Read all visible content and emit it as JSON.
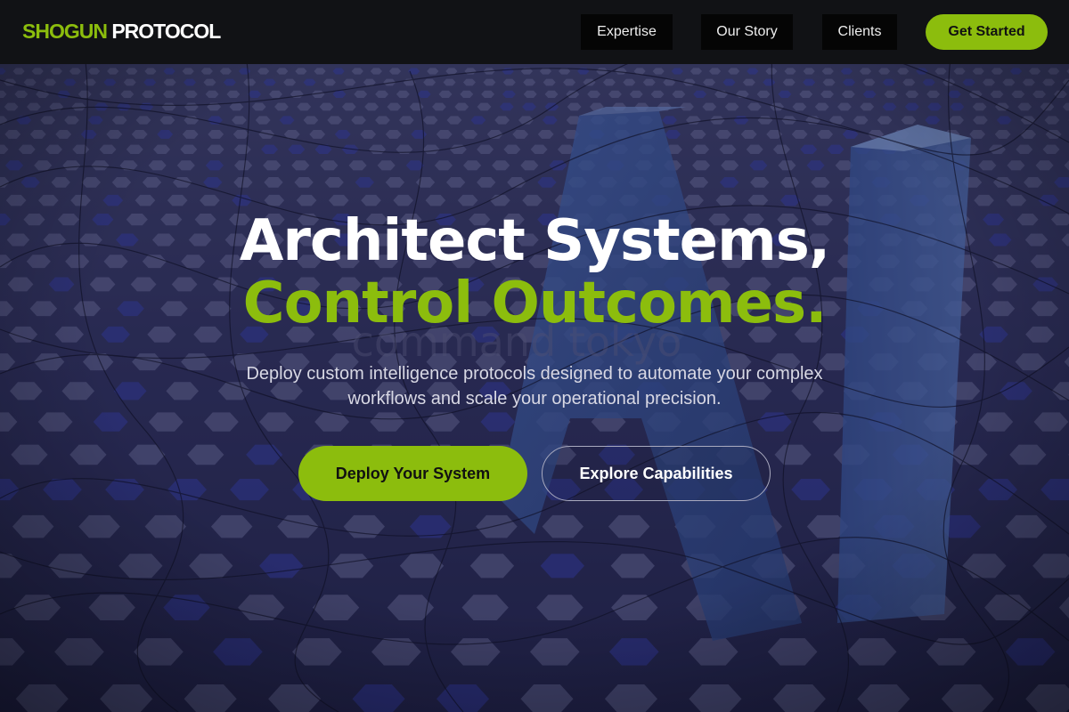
{
  "brand": {
    "part1": "SHOGUN",
    "part2": "PROTOCOL",
    "accent_color": "#8cbd0d"
  },
  "nav": {
    "links": [
      {
        "label": "Expertise"
      },
      {
        "label": "Our Story"
      },
      {
        "label": "Clients"
      }
    ],
    "cta_label": "Get Started"
  },
  "hero": {
    "headline_line1": "Architect Systems,",
    "headline_line2": "Control Outcomes.",
    "subtitle": "Deploy custom intelligence protocols designed to automate your complex workflows and scale your operational precision.",
    "primary_button": "Deploy Your System",
    "secondary_button": "Explore Capabilities",
    "background_image": "large-3d-letters-ai-on-hex-grid-floor",
    "background_watermark": "command tokyo"
  }
}
